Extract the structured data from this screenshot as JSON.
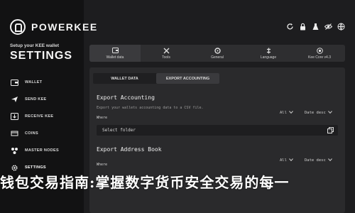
{
  "brand": {
    "name": "POWERKEE"
  },
  "sidebar": {
    "setup_caption": "Setup your KEE wallet",
    "title": "SETTINGS",
    "items": [
      {
        "label": "WALLET",
        "icon": "wallet-icon"
      },
      {
        "label": "SEND KEE",
        "icon": "send-icon"
      },
      {
        "label": "RECEIVE KEE",
        "icon": "receive-icon"
      },
      {
        "label": "COINS",
        "icon": "coins-icon"
      },
      {
        "label": "MASTER NODES",
        "icon": "nodes-icon"
      },
      {
        "label": "SETTINGS",
        "icon": "gear-icon"
      }
    ]
  },
  "top_icons": [
    "refresh-icon",
    "lock-icon",
    "flask-icon",
    "eye-icon",
    "globe-icon"
  ],
  "tabs": [
    {
      "label": "Wallet data",
      "icon": "wallet-icon"
    },
    {
      "label": "Tools",
      "icon": "tools-icon"
    },
    {
      "label": "General",
      "icon": "general-icon"
    },
    {
      "label": "Language",
      "icon": "language-icon"
    },
    {
      "label": "Kee Core v4.3",
      "icon": "core-icon"
    }
  ],
  "subtabs": [
    {
      "label": "WALLET DATA"
    },
    {
      "label": "EXPORT ACCOUNTING"
    }
  ],
  "export_accounting": {
    "title": "Export Accounting",
    "description": "Export your wallets accounting data to a CSV file.",
    "where_label": "Where",
    "filter_all": "All",
    "sort": "Date desc",
    "folder_placeholder": "Select folder"
  },
  "export_address_book": {
    "title": "Export Address Book",
    "where_label": "Where",
    "filter_all": "All",
    "sort": "Date desc"
  },
  "banner": {
    "text": "钱包交易指南:掌握数字货币安全交易的每一"
  },
  "colors": {
    "sidebar_bg": "#121213",
    "main_bg": "#1d1d1f",
    "panel_bg": "#2a2a2c"
  }
}
